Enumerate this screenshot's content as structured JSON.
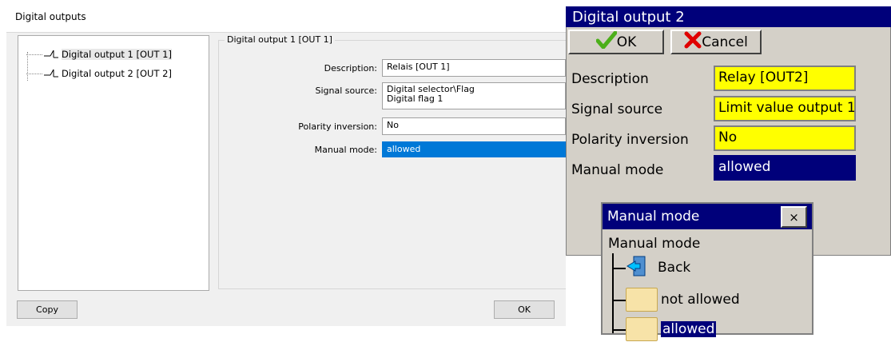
{
  "dialog": {
    "title": "Digital outputs",
    "tree": [
      {
        "label": "Digital output 1 [OUT 1]",
        "selected": true
      },
      {
        "label": "Digital output 2 [OUT 2]",
        "selected": false
      }
    ],
    "tree_icon": "switch-icon",
    "group_title": "Digital output 1 [OUT 1]",
    "fields": {
      "description": {
        "label": "Description:",
        "value": "Relais [OUT 1]"
      },
      "signal_source": {
        "label": "Signal source:",
        "value_line1": "Digital selector\\Flag",
        "value_line2": "Digital flag 1"
      },
      "polarity": {
        "label": "Polarity inversion:",
        "value": "No"
      },
      "manual_mode": {
        "label": "Manual mode:",
        "value": "allowed"
      }
    },
    "copy_button": "Copy",
    "ok_button": "OK"
  },
  "device": {
    "title": "Digital output 2",
    "ok_label": "OK",
    "cancel_label": "Cancel",
    "ok_icon": "check-icon",
    "cancel_icon": "x-icon",
    "rows": [
      {
        "label": "Description",
        "value": "Relay [OUT2]",
        "style": "yellow"
      },
      {
        "label": "Signal source",
        "value": "Limit value output 1",
        "style": "yellow"
      },
      {
        "label": "Polarity inversion",
        "value": "No",
        "style": "yellow"
      },
      {
        "label": "Manual mode",
        "value": "allowed",
        "style": "blue"
      }
    ],
    "popup": {
      "title": "Manual mode",
      "close": "×",
      "heading": "Manual mode",
      "items": [
        {
          "label": "Back",
          "icon": "back-icon"
        },
        {
          "label": "not allowed",
          "icon": "folder-icon"
        },
        {
          "label": "allowed",
          "icon": "folder-icon",
          "selected": true
        }
      ]
    }
  },
  "colors": {
    "accent_blue": "#0078d7",
    "device_title": "#00007a",
    "device_yellow": "#ffff00",
    "check_green": "#4caf1a",
    "cancel_red": "#e00000"
  }
}
